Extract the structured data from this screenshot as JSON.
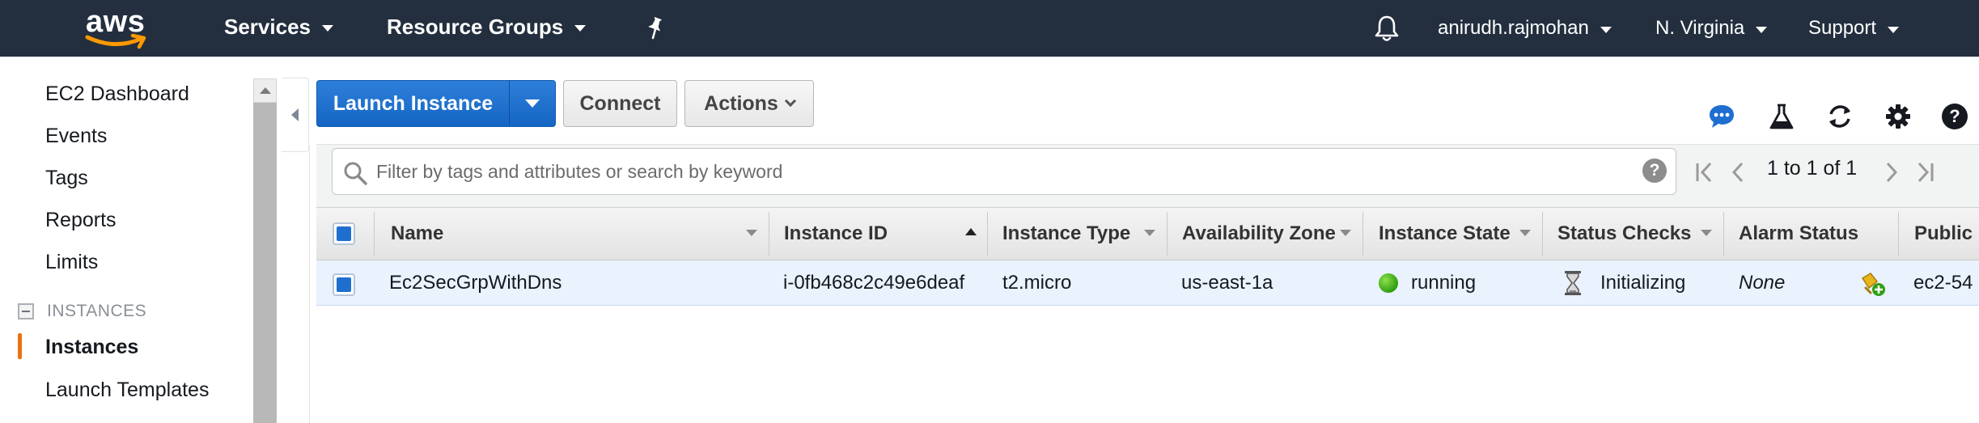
{
  "topnav": {
    "logo_text": "aws",
    "services_label": "Services",
    "resource_groups_label": "Resource Groups",
    "user_label": "anirudh.rajmohan",
    "region_label": "N. Virginia",
    "support_label": "Support",
    "icons": [
      "pin-icon",
      "bell-icon"
    ],
    "background_color": "#232f3e"
  },
  "sidebar": {
    "items": [
      {
        "label": "EC2 Dashboard"
      },
      {
        "label": "Events"
      },
      {
        "label": "Tags"
      },
      {
        "label": "Reports"
      },
      {
        "label": "Limits"
      }
    ],
    "section_label": "INSTANCES",
    "section_items": [
      {
        "label": "Instances",
        "active": true
      },
      {
        "label": "Launch Templates"
      }
    ],
    "accent_color": "#ec7211"
  },
  "toolbar": {
    "launch_label": "Launch Instance",
    "connect_label": "Connect",
    "actions_label": "Actions",
    "primary_color": "#1f6fd1",
    "icons": [
      "chat-icon",
      "flask-icon",
      "refresh-icon",
      "gear-icon",
      "help-icon"
    ]
  },
  "filter": {
    "placeholder": "Filter by tags and attributes or search by keyword",
    "help_label": "?",
    "pagination_text": "1 to 1 of 1"
  },
  "table": {
    "columns": [
      "Name",
      "Instance ID",
      "Instance Type",
      "Availability Zone",
      "Instance State",
      "Status Checks",
      "Alarm Status",
      "Public"
    ],
    "sorted_column": "Instance ID",
    "rows": [
      {
        "selected": true,
        "name": "Ec2SecGrpWithDns",
        "instance_id": "i-0fb468c2c49e6deaf",
        "instance_type": "t2.micro",
        "availability_zone": "us-east-1a",
        "instance_state": "running",
        "status_checks": "Initializing",
        "alarm_status": "None",
        "public_dns": "ec2-54"
      }
    ],
    "running_color": "#3ab01a",
    "selected_row_color": "#e9f2fd"
  }
}
